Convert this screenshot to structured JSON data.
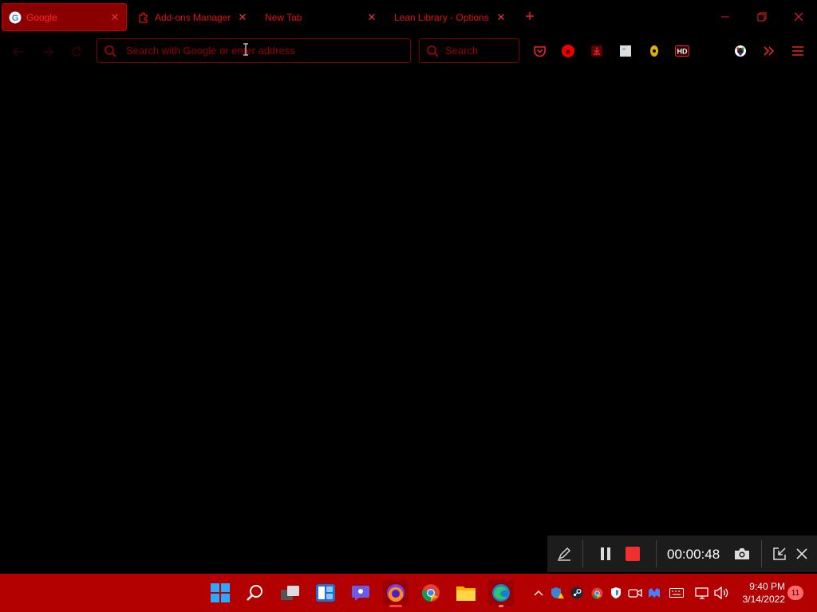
{
  "tabs": [
    {
      "title": "Google",
      "icon": "google-icon",
      "active": true
    },
    {
      "title": "Add-ons Manager",
      "icon": "puzzle-icon",
      "active": false
    },
    {
      "title": "New Tab",
      "icon": "",
      "active": false
    },
    {
      "title": "Lean Library - Options",
      "icon": "",
      "active": false
    }
  ],
  "urlbar": {
    "placeholder": "Search with Google or enter address",
    "value": ""
  },
  "searchbar": {
    "placeholder": "Search"
  },
  "recorder": {
    "time": "00:00:48"
  },
  "clock": {
    "time": "9:40 PM",
    "date": "3/14/2022"
  },
  "notifications": {
    "count": "11"
  },
  "colors": {
    "accent": "#c00000",
    "taskbar": "#b30000",
    "background": "#000000"
  }
}
